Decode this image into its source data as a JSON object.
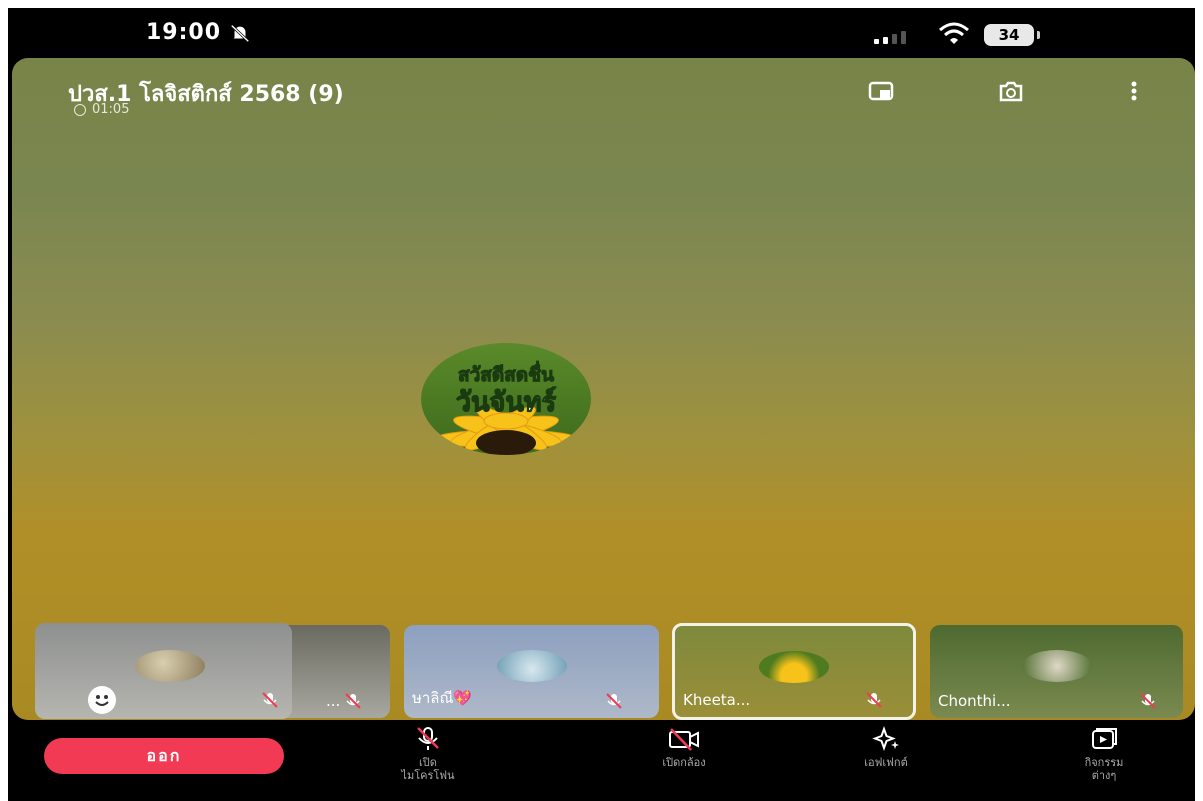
{
  "status": {
    "time": "19:00",
    "battery": "34"
  },
  "call": {
    "title": "ปวส.1 โลจิสติกส์ 2568 (9)",
    "timer": "01:05",
    "main_avatar_text_line1": "สวัสดีสดชื่น",
    "main_avatar_text_line2": "วันจันทร์"
  },
  "participants": [
    {
      "name": "..."
    },
    {
      "name": "ษาลิณี💖"
    },
    {
      "name": "Kheeta..."
    },
    {
      "name": "Chonthi..."
    }
  ],
  "controls": {
    "leave_label": "ออก",
    "mic_label_1": "เปิด",
    "mic_label_2": "ไมโครโฟน",
    "camera_label": "เปิดกล้อง",
    "effects_label": "เอฟเฟกต์",
    "activities_label_1": "กิจกรรม",
    "activities_label_2": "ต่างๆ"
  },
  "colors": {
    "leave": "#f23a55",
    "mic_off": "#f23a55"
  },
  "icons": [
    "bell-off-icon",
    "signal-icon",
    "wifi-icon",
    "battery-icon",
    "pip-icon",
    "camera-flip-icon",
    "more-icon",
    "clock-icon",
    "mic-off-icon",
    "camera-off-icon",
    "effects-icon",
    "activities-icon",
    "emoji-icon"
  ]
}
